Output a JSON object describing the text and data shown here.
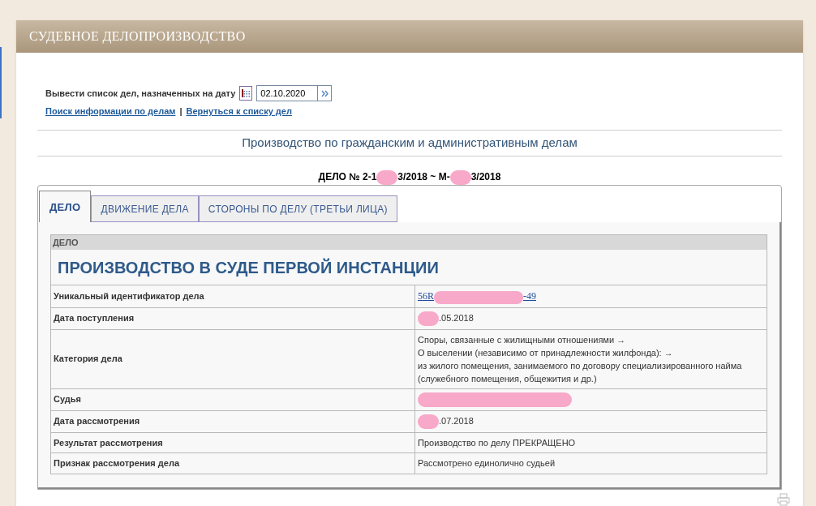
{
  "header": {
    "title": "СУДЕБНОЕ ДЕЛОПРОИЗВОДСТВО"
  },
  "date_filter": {
    "label": "Вывести список дел, назначенных на дату",
    "value": "02.10.2020"
  },
  "links": [
    "Поиск информации по делам",
    "Вернуться к списку дел"
  ],
  "link_separator": "|",
  "section_title": "Производство по гражданским и административным делам",
  "case_number": [
    {
      "kind": "text",
      "text": "ДЕЛО № 2-1"
    },
    {
      "kind": "redaction"
    },
    {
      "kind": "text",
      "text": "3/2018 ~ М-"
    },
    {
      "kind": "redaction"
    },
    {
      "kind": "text",
      "text": "3/2018"
    }
  ],
  "tabs": [
    {
      "label": "ДЕЛО",
      "selected": true
    },
    {
      "label": "ДВИЖЕНИЕ ДЕЛА",
      "selected": false
    },
    {
      "label": "СТОРОНЫ ПО ДЕЛУ (ТРЕТЬИ ЛИЦА)",
      "selected": false
    }
  ],
  "table": {
    "caption": "ДЕЛО",
    "heading": "ПРОИЗВОДСТВО В СУДЕ ПЕРВОЙ ИНСТАНЦИИ",
    "rows": [
      {
        "label": "Уникальный идентификатор дела",
        "kind": "link",
        "value": [
          {
            "kind": "text",
            "text": "56R"
          },
          {
            "kind": "redaction"
          },
          {
            "kind": "text",
            "text": "-49"
          }
        ]
      },
      {
        "label": "Дата поступления",
        "kind": "text",
        "value": [
          {
            "kind": "redaction"
          },
          {
            "kind": "text",
            "text": ".05.2018"
          }
        ]
      },
      {
        "label": "Категория дела",
        "kind": "lines",
        "value": [
          "Споры, связанные с жилищными отношениями →",
          "О выселении (независимо от принадлежности жилфонда): →",
          "из жилого помещения, занимаемого по договору специализированного найма",
          "(служебного помещения, общежития и др.)"
        ]
      },
      {
        "label": "Судья",
        "kind": "text",
        "value": [
          {
            "kind": "redaction"
          }
        ]
      },
      {
        "label": "Дата рассмотрения",
        "kind": "text",
        "value": [
          {
            "kind": "redaction"
          },
          {
            "kind": "text",
            "text": ".07.2018"
          }
        ]
      },
      {
        "label": "Результат рассмотрения",
        "kind": "text",
        "value": [
          {
            "kind": "text",
            "text": "Производство по делу ПРЕКРАЩЕНО"
          }
        ]
      },
      {
        "label": "Признак рассмотрения дела",
        "kind": "text",
        "value": [
          {
            "kind": "text",
            "text": "Рассмотрено единолично судьей"
          }
        ]
      }
    ]
  }
}
